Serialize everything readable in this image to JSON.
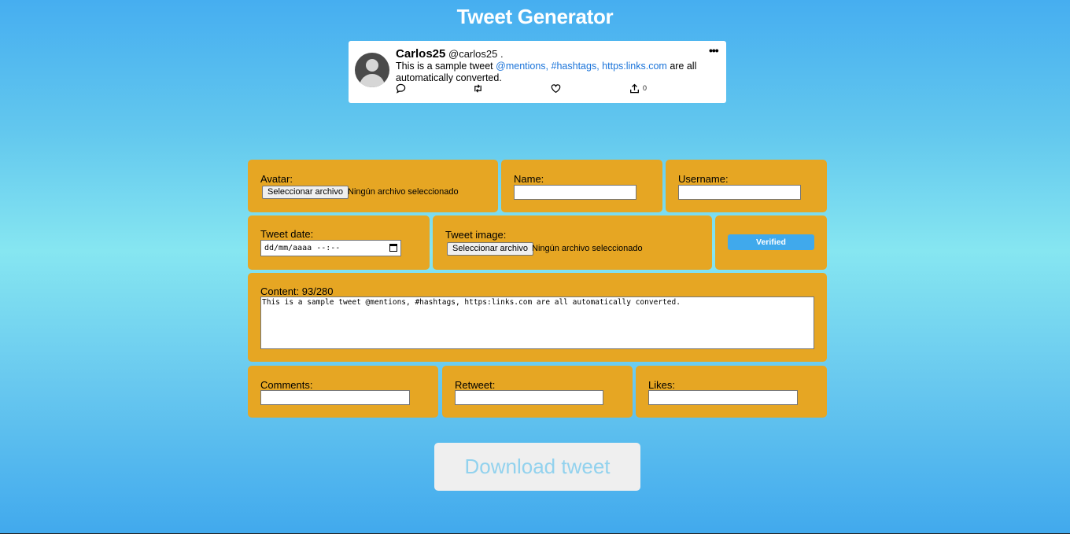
{
  "app": {
    "title": "Tweet Generator"
  },
  "tweet": {
    "name": "Carlos25",
    "handle": "@carlos25 .",
    "more_icon": "•••",
    "text_start": "This is a sample tweet ",
    "mention": "@mentions,",
    "hashtag": "#hashtags,",
    "link": "https:links.com",
    "text_end": " are all automatically converted.",
    "share_count": "0",
    "icons": [
      "comment-icon",
      "retweet-icon",
      "like-icon",
      "share-icon"
    ]
  },
  "form": {
    "avatar": {
      "label": "Avatar:",
      "button": "Seleccionar archivo",
      "status": "Ningún archivo seleccionado"
    },
    "name": {
      "label": "Name:",
      "value": ""
    },
    "username": {
      "label": "Username:",
      "value": ""
    },
    "tweet_date": {
      "label": "Tweet date:",
      "placeholder": "dd/mm/aaaa --:--"
    },
    "tweet_image": {
      "label": "Tweet image:",
      "button": "Seleccionar archivo",
      "status": "Ningún archivo seleccionado"
    },
    "verified": {
      "label": "Verified"
    },
    "content": {
      "label": "Content: 93/280",
      "value": "This is a sample tweet @mentions, #hashtags, https:links.com are all automatically converted."
    },
    "comments": {
      "label": "Comments:",
      "value": ""
    },
    "retweet": {
      "label": "Retweet:",
      "value": ""
    },
    "likes": {
      "label": "Likes:",
      "value": ""
    }
  },
  "download": {
    "label": "Download tweet"
  },
  "colors": {
    "panel": "#e6a623",
    "accent": "#40a9ec",
    "link": "#1a73d9"
  }
}
